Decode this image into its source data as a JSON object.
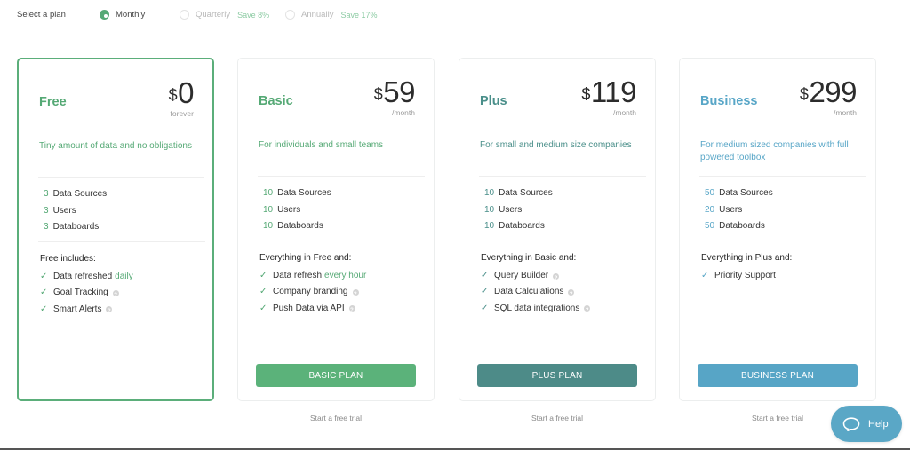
{
  "billing": {
    "label": "Select a plan",
    "options": [
      {
        "label": "Monthly",
        "selected": true,
        "save": ""
      },
      {
        "label": "Quarterly",
        "selected": false,
        "save": "Save 8%"
      },
      {
        "label": "Annually",
        "selected": false,
        "save": "Save 17%"
      }
    ]
  },
  "plans": [
    {
      "name": "Free",
      "currency": "$",
      "price": "0",
      "period": "forever",
      "description": "Tiny amount of data and no obligations",
      "accent": "#55a975",
      "limits": [
        {
          "num": "3",
          "label": "Data Sources"
        },
        {
          "num": "3",
          "label": "Users"
        },
        {
          "num": "3",
          "label": "Databoards"
        }
      ],
      "features_title": "Free includes:",
      "features": [
        {
          "text": "Data refreshed ",
          "highlight": "daily",
          "help": false
        },
        {
          "text": "Goal Tracking",
          "highlight": "",
          "help": true
        },
        {
          "text": "Smart Alerts",
          "highlight": "",
          "help": true
        }
      ],
      "button": "",
      "trial": ""
    },
    {
      "name": "Basic",
      "currency": "$",
      "price": "59",
      "period": "/month",
      "description": "For individuals and small teams",
      "accent": "#55a975",
      "limits": [
        {
          "num": "10",
          "label": "Data Sources"
        },
        {
          "num": "10",
          "label": "Users"
        },
        {
          "num": "10",
          "label": "Databoards"
        }
      ],
      "features_title": "Everything in Free and:",
      "features": [
        {
          "text": "Data refresh ",
          "highlight": "every hour",
          "help": false
        },
        {
          "text": "Company branding",
          "highlight": "",
          "help": true
        },
        {
          "text": "Push Data via API",
          "highlight": "",
          "help": true
        }
      ],
      "button": "BASIC PLAN",
      "button_color": "#5bb27a",
      "trial": "Start a free trial"
    },
    {
      "name": "Plus",
      "currency": "$",
      "price": "119",
      "period": "/month",
      "description": "For small and medium size companies",
      "accent": "#4a8f8a",
      "limits": [
        {
          "num": "10",
          "label": "Data Sources"
        },
        {
          "num": "10",
          "label": "Users"
        },
        {
          "num": "10",
          "label": "Databoards"
        }
      ],
      "features_title": "Everything in Basic and:",
      "features": [
        {
          "text": "Query Builder",
          "highlight": "",
          "help": true
        },
        {
          "text": "Data Calculations",
          "highlight": "",
          "help": true
        },
        {
          "text": "SQL data integrations",
          "highlight": "",
          "help": true
        }
      ],
      "button": "PLUS PLAN",
      "button_color": "#4d8b88",
      "trial": "Start a free trial"
    },
    {
      "name": "Business",
      "currency": "$",
      "price": "299",
      "period": "/month",
      "description": "For medium sized companies with full powered toolbox",
      "accent": "#58a6c7",
      "limits": [
        {
          "num": "50",
          "label": "Data Sources"
        },
        {
          "num": "20",
          "label": "Users"
        },
        {
          "num": "50",
          "label": "Databoards"
        }
      ],
      "features_title": "Everything in Plus and:",
      "features": [
        {
          "text": "Priority Support",
          "highlight": "",
          "help": false
        }
      ],
      "button": "BUSINESS PLAN",
      "button_color": "#57a5c6",
      "trial": "Start a free trial"
    }
  ],
  "help_widget": {
    "label": "Help",
    "icon": "chat-bubble-icon"
  }
}
